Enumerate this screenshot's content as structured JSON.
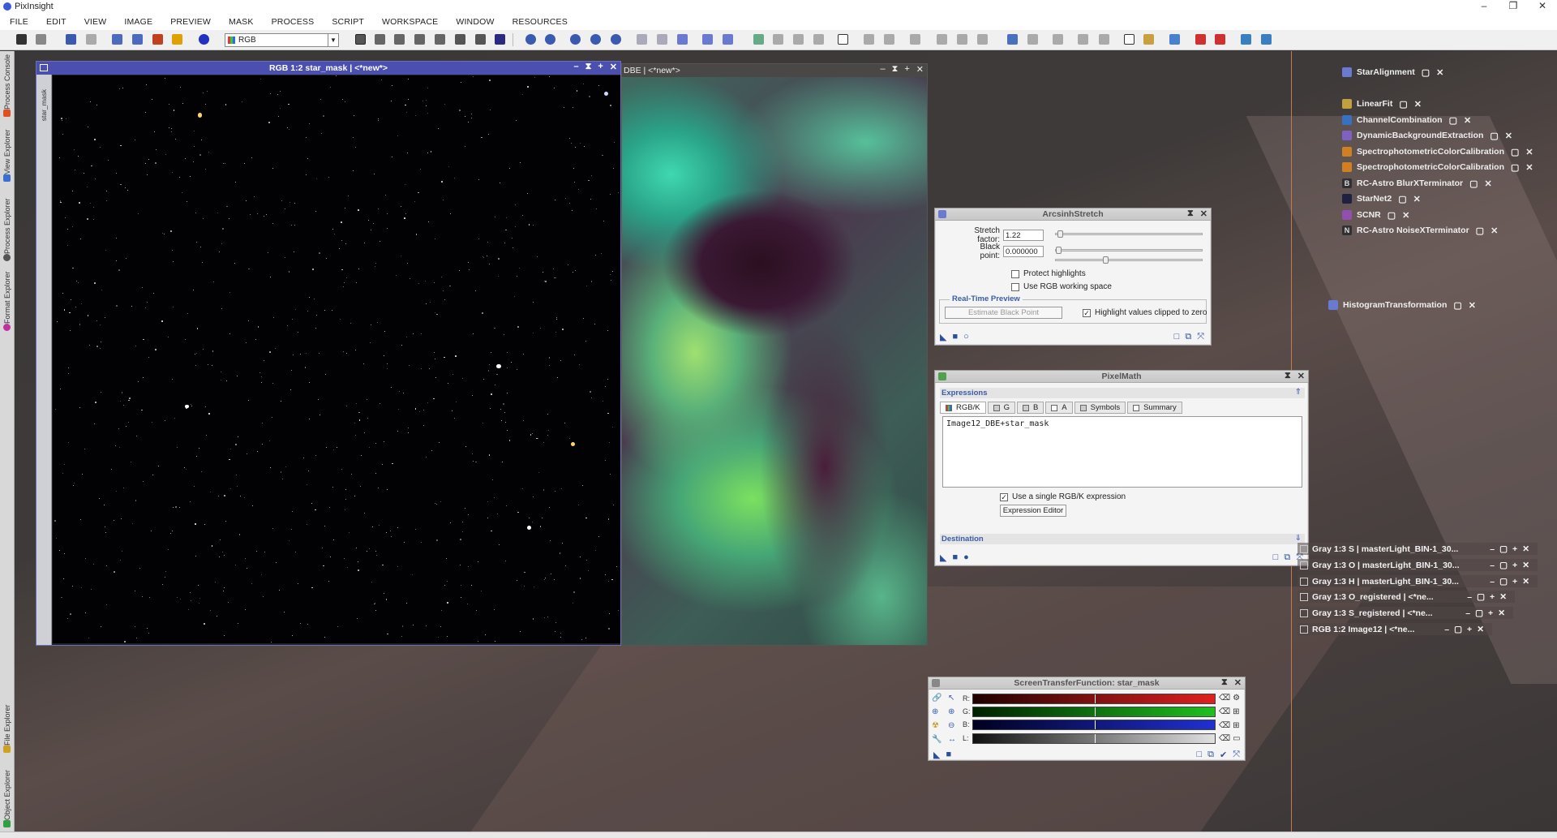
{
  "app": {
    "title": "PixInsight",
    "window_controls": [
      "–",
      "❐",
      "✕"
    ]
  },
  "menu": [
    "FILE",
    "EDIT",
    "VIEW",
    "IMAGE",
    "PREVIEW",
    "MASK",
    "PROCESS",
    "SCRIPT",
    "WORKSPACE",
    "WINDOW",
    "RESOURCES"
  ],
  "toolbar": {
    "colorspace_value": "RGB"
  },
  "left_tabs": [
    "Process Console",
    "View Explorer",
    "Process Explorer",
    "Format Explorer",
    "File Explorer",
    "Object Explorer"
  ],
  "image_windows": {
    "star_mask": {
      "title": "RGB 1:2 star_mask | <*new*>",
      "side_label": "star_mask"
    },
    "dbe": {
      "title": "DBE | <*new*>"
    }
  },
  "arcsinh": {
    "title": "ArcsinhStretch",
    "stretch_label": "Stretch factor:",
    "stretch_value": "1.22",
    "black_label": "Black point:",
    "black_value": "0.000000",
    "protect_label": "Protect highlights",
    "rgbws_label": "Use RGB working space",
    "preview_section": "Real-Time Preview",
    "estimate_button": "Estimate Black Point",
    "highlight_label": "Highlight values clipped to zero"
  },
  "pixelmath": {
    "title": "PixelMath",
    "expressions_section": "Expressions",
    "tabs": [
      "RGB/K",
      "G",
      "B",
      "A",
      "Symbols",
      "Summary"
    ],
    "expression": "Image12_DBE+star_mask",
    "single_expr_label": "Use a single RGB/K expression",
    "editor_button": "Expression Editor",
    "destination_section": "Destination"
  },
  "stf": {
    "title": "ScreenTransferFunction: star_mask",
    "channels": [
      "R:",
      "G:",
      "B:",
      "L:"
    ],
    "colors": {
      "R": "#e02020",
      "G": "#20c020",
      "B": "#2030d0",
      "L": "#b0b0b0"
    }
  },
  "process_icons": [
    {
      "label": "StarAlignment",
      "color": "#6a7ad0"
    },
    {
      "label": "LinearFit",
      "color": "#c0a040"
    },
    {
      "label": "ChannelCombination",
      "color": "#3a70c0"
    },
    {
      "label": "DynamicBackgroundExtraction",
      "color": "#8060c0"
    },
    {
      "label": "SpectrophotometricColorCalibration",
      "color": "#d08020"
    },
    {
      "label": "SpectrophotometricColorCalibration",
      "color": "#d08020"
    },
    {
      "label": "RC-Astro BlurXTerminator",
      "color": "#303030",
      "glyph": "B"
    },
    {
      "label": "StarNet2",
      "color": "#202040"
    },
    {
      "label": "SCNR",
      "color": "#9050b0"
    },
    {
      "label": "RC-Astro NoiseXTerminator",
      "color": "#303030",
      "glyph": "N"
    },
    {
      "label": "HistogramTransformation",
      "color": "#6a7ad0"
    }
  ],
  "image_icons": [
    "Gray 1:3 S | masterLight_BIN-1_30...",
    "Gray 1:3 O | masterLight_BIN-1_30...",
    "Gray 1:3 H | masterLight_BIN-1_30...",
    "Gray 1:3 O_registered | <*ne...",
    "Gray 1:3 S_registered | <*ne...",
    "RGB 1:2 Image12 | <*ne..."
  ]
}
